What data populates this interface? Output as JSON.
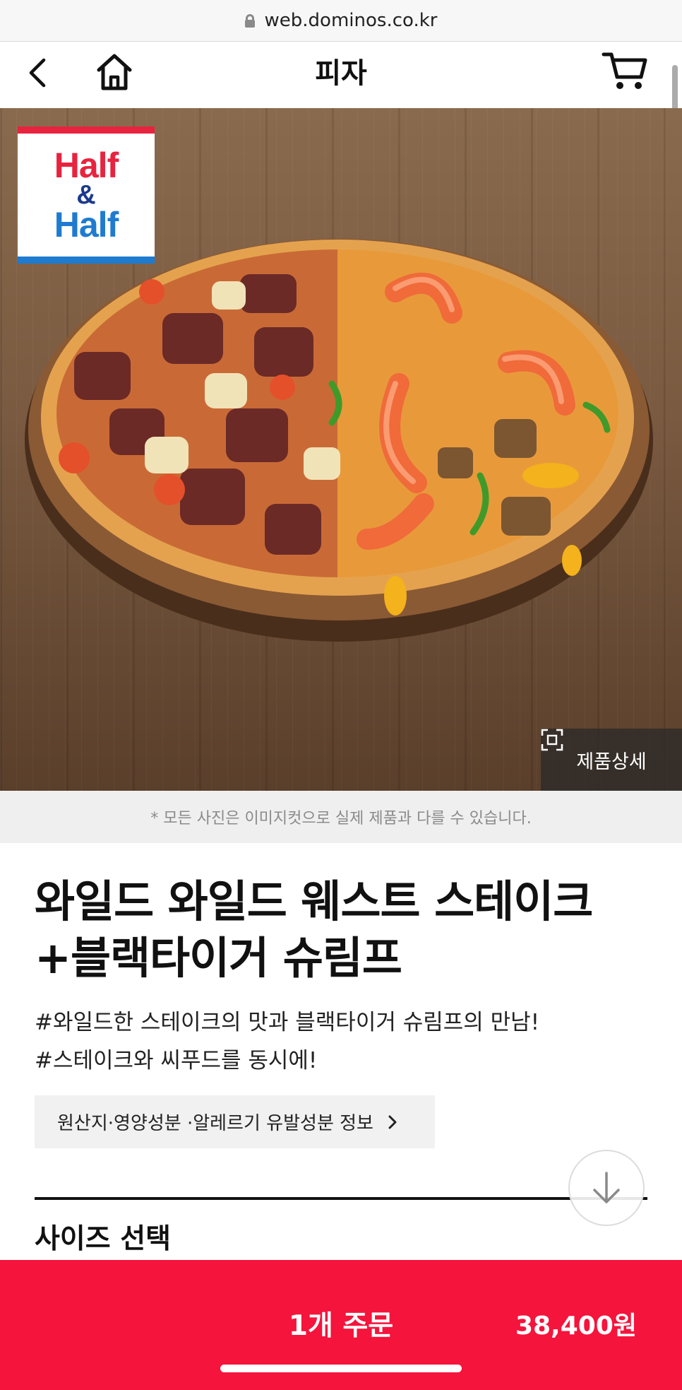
{
  "browser": {
    "url": "web.dominos.co.kr"
  },
  "header": {
    "title": "피자"
  },
  "hero": {
    "badge": {
      "line1": "Half",
      "line2": "&",
      "line3": "Half"
    },
    "detail_label": "제품상세"
  },
  "notice": "* 모든 사진은 이미지컷으로 실제 제품과 다를 수 있습니다.",
  "product": {
    "name_line1": "와일드 와일드 웨스트 스테이크",
    "name_line2": "+블랙타이거 슈림프",
    "desc_line1": "#와일드한 스테이크의 맛과 블랙타이거 슈림프의 만남!",
    "desc_line2": "#스테이크와 씨푸드를 동시에!",
    "info_label": "원산지·영양성분 ·알레르기 유발성분 정보"
  },
  "size_section": {
    "title": "사이즈 선택"
  },
  "order": {
    "qty_label": "1개 주문",
    "price": "38,400원"
  },
  "colors": {
    "accent": "#f5143c",
    "badge_red": "#e8233f",
    "badge_blue": "#1f7bd0"
  }
}
